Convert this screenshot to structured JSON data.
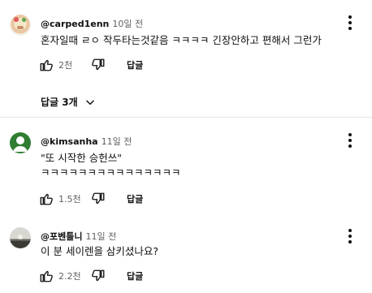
{
  "comments": [
    {
      "author": "@carped1enn",
      "time": "10일 전",
      "lines": [
        "혼자일때 ㄹㅇ 작두타는것같음 ㅋㅋㅋㅋ 긴장안하고 편해서 그런가"
      ],
      "likes": "2천",
      "reply_label": "답글",
      "avatar": "avatar-illustration"
    },
    {
      "author": "@kimsanha",
      "time": "11일 전",
      "lines": [
        "\"또 시작한 승헌쓰\"",
        "ㅋㅋㅋㅋㅋㅋㅋㅋㅋㅋㅋㅋㅋㅋㅋ"
      ],
      "likes": "1.5천",
      "reply_label": "답글",
      "avatar": "avatar-green"
    },
    {
      "author": "@포벤틀니",
      "time": "11일 전",
      "lines": [
        "이 분 세이렌을 삼키셨나요?"
      ],
      "likes": "2.2천",
      "reply_label": "답글",
      "avatar": "avatar-sunset"
    }
  ],
  "replies_toggle": {
    "label": "답글 3개",
    "icon": "chevron-down-icon"
  },
  "icons": {
    "like": "thumbs-up-icon",
    "dislike": "thumbs-down-icon",
    "more": "more-vert-icon"
  }
}
